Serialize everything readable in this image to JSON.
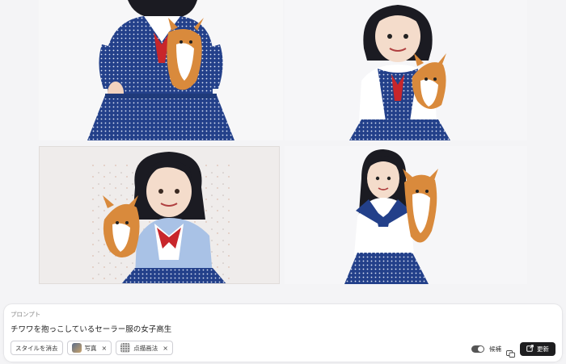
{
  "images": [
    {
      "alt": "image-1"
    },
    {
      "alt": "image-2"
    },
    {
      "alt": "image-3"
    },
    {
      "alt": "image-4"
    }
  ],
  "prompt_panel": {
    "label": "プロンプト",
    "text": "チワワを抱っこしているセーラー服の女子高生",
    "clear_style_label": "スタイルを消去",
    "chips": [
      {
        "label": "写真",
        "icon": "photo-style-thumb"
      },
      {
        "label": "点描画法",
        "icon": "pointillism-style-thumb"
      }
    ],
    "chip_remove_glyph": "×",
    "toggle_label": "候補",
    "update_label": "更新"
  },
  "colors": {
    "navy": "#1f3a7a",
    "red_bow": "#c8262b",
    "button_dark": "#1d1d1f"
  }
}
